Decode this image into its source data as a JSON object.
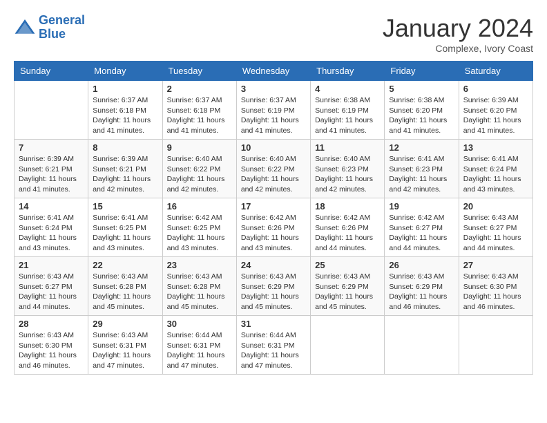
{
  "header": {
    "logo_line1": "General",
    "logo_line2": "Blue",
    "month": "January 2024",
    "location": "Complexe, Ivory Coast"
  },
  "days_of_week": [
    "Sunday",
    "Monday",
    "Tuesday",
    "Wednesday",
    "Thursday",
    "Friday",
    "Saturday"
  ],
  "weeks": [
    [
      {
        "day": "",
        "sunrise": "",
        "sunset": "",
        "daylight": ""
      },
      {
        "day": "1",
        "sunrise": "Sunrise: 6:37 AM",
        "sunset": "Sunset: 6:18 PM",
        "daylight": "Daylight: 11 hours and 41 minutes."
      },
      {
        "day": "2",
        "sunrise": "Sunrise: 6:37 AM",
        "sunset": "Sunset: 6:18 PM",
        "daylight": "Daylight: 11 hours and 41 minutes."
      },
      {
        "day": "3",
        "sunrise": "Sunrise: 6:37 AM",
        "sunset": "Sunset: 6:19 PM",
        "daylight": "Daylight: 11 hours and 41 minutes."
      },
      {
        "day": "4",
        "sunrise": "Sunrise: 6:38 AM",
        "sunset": "Sunset: 6:19 PM",
        "daylight": "Daylight: 11 hours and 41 minutes."
      },
      {
        "day": "5",
        "sunrise": "Sunrise: 6:38 AM",
        "sunset": "Sunset: 6:20 PM",
        "daylight": "Daylight: 11 hours and 41 minutes."
      },
      {
        "day": "6",
        "sunrise": "Sunrise: 6:39 AM",
        "sunset": "Sunset: 6:20 PM",
        "daylight": "Daylight: 11 hours and 41 minutes."
      }
    ],
    [
      {
        "day": "7",
        "sunrise": "Sunrise: 6:39 AM",
        "sunset": "Sunset: 6:21 PM",
        "daylight": "Daylight: 11 hours and 41 minutes."
      },
      {
        "day": "8",
        "sunrise": "Sunrise: 6:39 AM",
        "sunset": "Sunset: 6:21 PM",
        "daylight": "Daylight: 11 hours and 42 minutes."
      },
      {
        "day": "9",
        "sunrise": "Sunrise: 6:40 AM",
        "sunset": "Sunset: 6:22 PM",
        "daylight": "Daylight: 11 hours and 42 minutes."
      },
      {
        "day": "10",
        "sunrise": "Sunrise: 6:40 AM",
        "sunset": "Sunset: 6:22 PM",
        "daylight": "Daylight: 11 hours and 42 minutes."
      },
      {
        "day": "11",
        "sunrise": "Sunrise: 6:40 AM",
        "sunset": "Sunset: 6:23 PM",
        "daylight": "Daylight: 11 hours and 42 minutes."
      },
      {
        "day": "12",
        "sunrise": "Sunrise: 6:41 AM",
        "sunset": "Sunset: 6:23 PM",
        "daylight": "Daylight: 11 hours and 42 minutes."
      },
      {
        "day": "13",
        "sunrise": "Sunrise: 6:41 AM",
        "sunset": "Sunset: 6:24 PM",
        "daylight": "Daylight: 11 hours and 43 minutes."
      }
    ],
    [
      {
        "day": "14",
        "sunrise": "Sunrise: 6:41 AM",
        "sunset": "Sunset: 6:24 PM",
        "daylight": "Daylight: 11 hours and 43 minutes."
      },
      {
        "day": "15",
        "sunrise": "Sunrise: 6:41 AM",
        "sunset": "Sunset: 6:25 PM",
        "daylight": "Daylight: 11 hours and 43 minutes."
      },
      {
        "day": "16",
        "sunrise": "Sunrise: 6:42 AM",
        "sunset": "Sunset: 6:25 PM",
        "daylight": "Daylight: 11 hours and 43 minutes."
      },
      {
        "day": "17",
        "sunrise": "Sunrise: 6:42 AM",
        "sunset": "Sunset: 6:26 PM",
        "daylight": "Daylight: 11 hours and 43 minutes."
      },
      {
        "day": "18",
        "sunrise": "Sunrise: 6:42 AM",
        "sunset": "Sunset: 6:26 PM",
        "daylight": "Daylight: 11 hours and 44 minutes."
      },
      {
        "day": "19",
        "sunrise": "Sunrise: 6:42 AM",
        "sunset": "Sunset: 6:27 PM",
        "daylight": "Daylight: 11 hours and 44 minutes."
      },
      {
        "day": "20",
        "sunrise": "Sunrise: 6:43 AM",
        "sunset": "Sunset: 6:27 PM",
        "daylight": "Daylight: 11 hours and 44 minutes."
      }
    ],
    [
      {
        "day": "21",
        "sunrise": "Sunrise: 6:43 AM",
        "sunset": "Sunset: 6:27 PM",
        "daylight": "Daylight: 11 hours and 44 minutes."
      },
      {
        "day": "22",
        "sunrise": "Sunrise: 6:43 AM",
        "sunset": "Sunset: 6:28 PM",
        "daylight": "Daylight: 11 hours and 45 minutes."
      },
      {
        "day": "23",
        "sunrise": "Sunrise: 6:43 AM",
        "sunset": "Sunset: 6:28 PM",
        "daylight": "Daylight: 11 hours and 45 minutes."
      },
      {
        "day": "24",
        "sunrise": "Sunrise: 6:43 AM",
        "sunset": "Sunset: 6:29 PM",
        "daylight": "Daylight: 11 hours and 45 minutes."
      },
      {
        "day": "25",
        "sunrise": "Sunrise: 6:43 AM",
        "sunset": "Sunset: 6:29 PM",
        "daylight": "Daylight: 11 hours and 45 minutes."
      },
      {
        "day": "26",
        "sunrise": "Sunrise: 6:43 AM",
        "sunset": "Sunset: 6:29 PM",
        "daylight": "Daylight: 11 hours and 46 minutes."
      },
      {
        "day": "27",
        "sunrise": "Sunrise: 6:43 AM",
        "sunset": "Sunset: 6:30 PM",
        "daylight": "Daylight: 11 hours and 46 minutes."
      }
    ],
    [
      {
        "day": "28",
        "sunrise": "Sunrise: 6:43 AM",
        "sunset": "Sunset: 6:30 PM",
        "daylight": "Daylight: 11 hours and 46 minutes."
      },
      {
        "day": "29",
        "sunrise": "Sunrise: 6:43 AM",
        "sunset": "Sunset: 6:31 PM",
        "daylight": "Daylight: 11 hours and 47 minutes."
      },
      {
        "day": "30",
        "sunrise": "Sunrise: 6:44 AM",
        "sunset": "Sunset: 6:31 PM",
        "daylight": "Daylight: 11 hours and 47 minutes."
      },
      {
        "day": "31",
        "sunrise": "Sunrise: 6:44 AM",
        "sunset": "Sunset: 6:31 PM",
        "daylight": "Daylight: 11 hours and 47 minutes."
      },
      {
        "day": "",
        "sunrise": "",
        "sunset": "",
        "daylight": ""
      },
      {
        "day": "",
        "sunrise": "",
        "sunset": "",
        "daylight": ""
      },
      {
        "day": "",
        "sunrise": "",
        "sunset": "",
        "daylight": ""
      }
    ]
  ]
}
